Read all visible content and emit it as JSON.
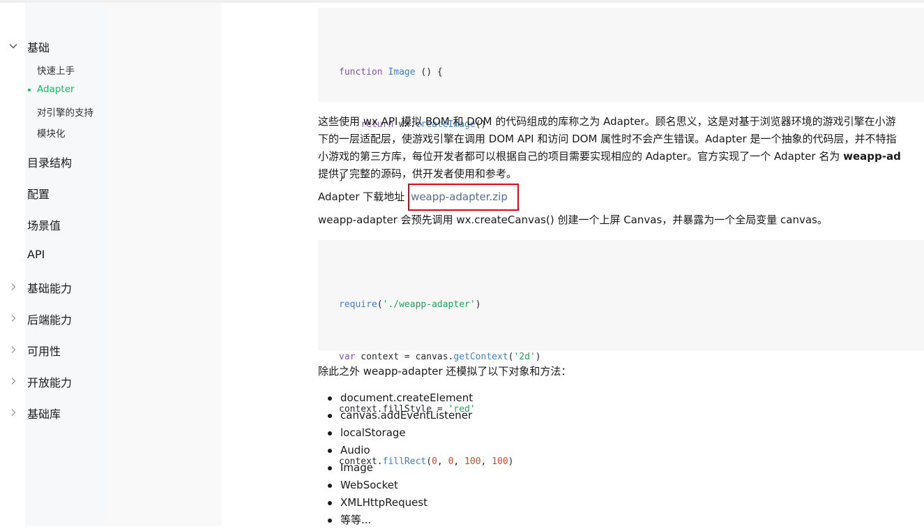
{
  "sidebar": {
    "group_basic": {
      "label": "基础"
    },
    "sub_items": [
      {
        "label": "快速上手"
      },
      {
        "label": "Adapter",
        "active": true
      },
      {
        "label": "对引擎的支持"
      },
      {
        "label": "模块化"
      }
    ],
    "items": [
      {
        "label": "目录结构"
      },
      {
        "label": "配置"
      },
      {
        "label": "场景值"
      },
      {
        "label": "API"
      },
      {
        "label": "基础能力"
      },
      {
        "label": "后端能力"
      },
      {
        "label": "可用性"
      },
      {
        "label": "开放能力"
      },
      {
        "label": "基础库"
      }
    ]
  },
  "colors": {
    "accent": "#07c160",
    "link": "#576b95",
    "highlight_border": "#e60012"
  },
  "code1": {
    "line1_kw": "function",
    "line1_fn": "Image",
    "line1_rest": " () {",
    "line2_kw": "return",
    "line2_obj": " wx.",
    "line2_fn": "createImage",
    "line2_rest": "()",
    "line3": "}"
  },
  "para1": {
    "line1": "这些使用 wx API 模拟 BOM 和 DOM 的代码组成的库称之为 Adapter。顾名思义，这是对基于浏览器环境的游戏引擎在小游",
    "line2": "下的一层适配层，使游戏引擎在调用 DOM API 和访问 DOM 属性时不会产生错误。Adapter 是一个抽象的代码层，并不特指",
    "line3_pre": "小游戏的第三方库，每位开发者都可以根据自己的项目需要实现相应的 Adapter。官方实现了一个 Adapter 名为 ",
    "line3_bold": "weapp-ad",
    "line4": "提供了完整的源码，供开发者使用和参考。"
  },
  "download": {
    "label": "Adapter 下载地址",
    "link_text": "weapp-adapter.zip"
  },
  "para2": "weapp-adapter 会预先调用 wx.createCanvas() 创建一个上屏 Canvas，并暴露为一个全局变量 canvas。",
  "code2": {
    "l1_fn": "require",
    "l1_p1": "(",
    "l1_str": "'./weapp-adapter'",
    "l1_p2": ")",
    "l2_kw": "var",
    "l2_mid": " context = canvas.",
    "l2_fn": "getContext",
    "l2_p1": "(",
    "l2_str": "'2d'",
    "l2_p2": ")",
    "l3_pre": "context.fillStyle = ",
    "l3_str": "'red'",
    "l4_pre": "context.",
    "l4_fn": "fillRect",
    "l4_p1": "(",
    "l4_n1": "0",
    "l4_c1": ", ",
    "l4_n2": "0",
    "l4_c2": ", ",
    "l4_n3": "100",
    "l4_c3": ", ",
    "l4_n4": "100",
    "l4_p2": ")"
  },
  "para3": "除此之外 weapp-adapter 还模拟了以下对象和方法：",
  "api_list": [
    "document.createElement",
    "canvas.addEventListener",
    "localStorage",
    "Audio",
    "Image",
    "WebSocket",
    "XMLHttpRequest",
    "等等..."
  ]
}
